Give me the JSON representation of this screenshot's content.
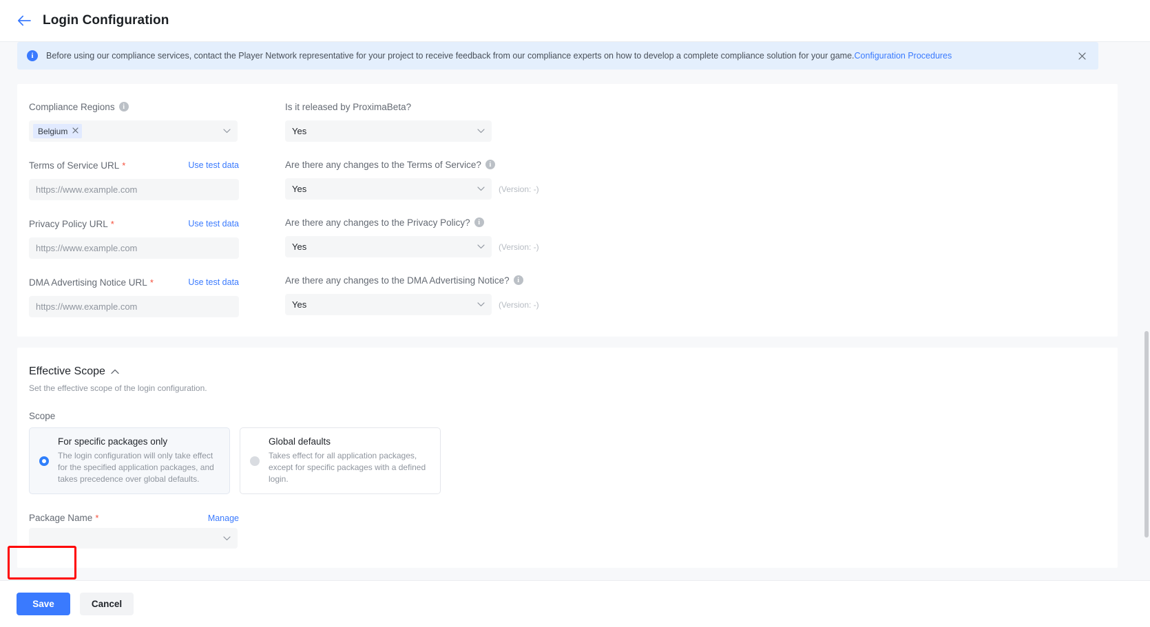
{
  "header": {
    "back_icon": "arrow-left-icon",
    "title": "Login Configuration"
  },
  "alert": {
    "icon": "info-icon",
    "message": "Before using our compliance services, contact the Player Network representative for your project to receive feedback from our compliance experts on how to develop a complete compliance solution for your game.",
    "link_label": "Configuration Procedures",
    "close_icon": "close-icon"
  },
  "compliance": {
    "regions": {
      "label": "Compliance Regions",
      "tags": [
        {
          "label": "Belgium",
          "remove_icon": "close-icon"
        }
      ]
    },
    "tos_url": {
      "label": "Terms of Service URL",
      "required": "*",
      "action_label": "Use test data",
      "value": "https://www.example.com"
    },
    "privacy_url": {
      "label": "Privacy Policy URL",
      "required": "*",
      "action_label": "Use test data",
      "value": "https://www.example.com"
    },
    "dma_url": {
      "label": "DMA Advertising Notice URL",
      "required": "*",
      "action_label": "Use test data",
      "value": "https://www.example.com"
    },
    "proxima": {
      "label": "Is it released by ProximaBeta?",
      "value": "Yes"
    },
    "tos_changes": {
      "label": "Are there any changes to the Terms of Service?",
      "value": "Yes",
      "version": "(Version: -)"
    },
    "privacy_changes": {
      "label": "Are there any changes to the Privacy Policy?",
      "value": "Yes",
      "version": "(Version: -)"
    },
    "dma_changes": {
      "label": "Are there any changes to the DMA Advertising Notice?",
      "value": "Yes",
      "version": "(Version: -)"
    }
  },
  "effective_scope": {
    "title": "Effective Scope",
    "collapse_icon": "chevron-up-icon",
    "subtitle": "Set the effective scope of the login configuration.",
    "scope_label": "Scope",
    "options": [
      {
        "title": "For specific packages only",
        "description": "The login configuration will only take effect for the specified application packages, and takes precedence over global defaults.",
        "selected": true
      },
      {
        "title": "Global defaults",
        "description": "Takes effect for all application packages, except for specific packages with a defined login.",
        "selected": false
      }
    ],
    "package_name": {
      "label": "Package Name",
      "required": "*",
      "action_label": "Manage",
      "value": ""
    }
  },
  "footer": {
    "save_label": "Save",
    "cancel_label": "Cancel"
  },
  "colors": {
    "accent": "#3a7afe",
    "alert_bg": "#e4effd",
    "required": "#f5503c",
    "highlight": "#ff0000"
  }
}
